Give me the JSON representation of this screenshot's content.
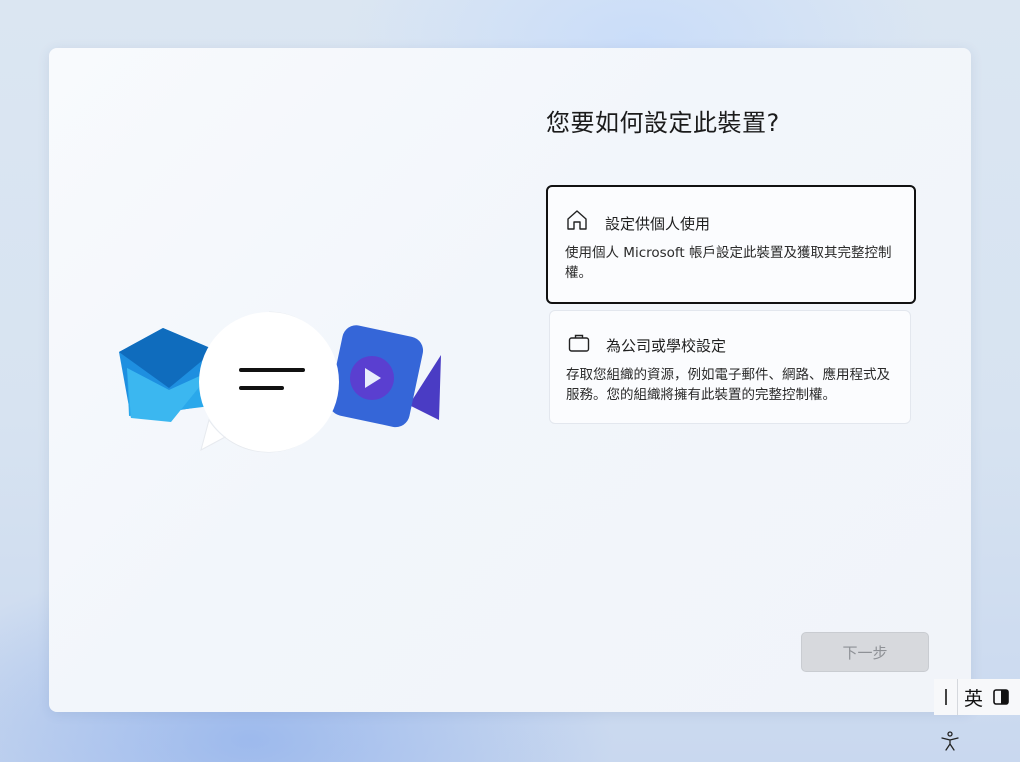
{
  "page": {
    "title": "您要如何設定此裝置?"
  },
  "options": [
    {
      "icon": "home-icon",
      "title": "設定供個人使用",
      "description": "使用個人 Microsoft 帳戶設定此裝置及獲取其完整控制權。",
      "selected": true
    },
    {
      "icon": "briefcase-icon",
      "title": "為公司或學校設定",
      "description": "存取您組織的資源，例如電子郵件、網路、應用程式及服務。您的組織將擁有此裝置的完整控制權。",
      "selected": false
    }
  ],
  "illustration": {
    "icons": [
      "mail-icon",
      "chat-bubble-icon",
      "video-camera-icon"
    ]
  },
  "footer": {
    "next_label": "下一步",
    "next_enabled": false
  },
  "taskbar": {
    "ime_language": "英",
    "accessibility_icon": "accessibility-icon"
  },
  "colors": {
    "selected_border": "#111111",
    "disabled_button": "#d7d9dd"
  }
}
